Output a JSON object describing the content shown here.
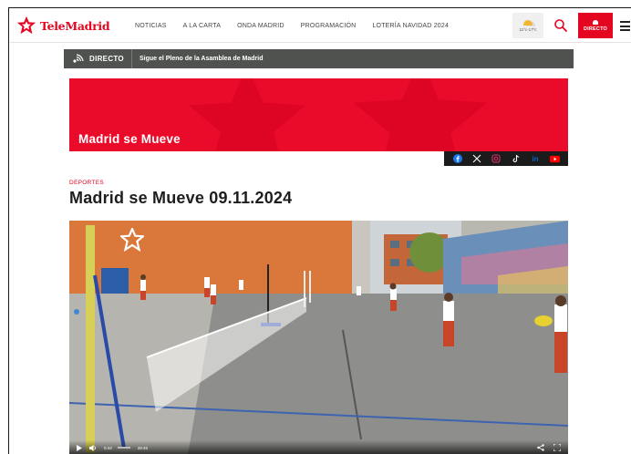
{
  "header": {
    "logo_text": "TeleMadrid",
    "nav": [
      "NOTICIAS",
      "A LA CARTA",
      "ONDA MADRID",
      "PROGRAMACIÓN",
      "LOTERÍA NAVIDAD 2024"
    ],
    "weather_text": "11ºc-17ºc",
    "directo_label": "DIRECTO",
    "brand_color": "#e40521"
  },
  "live": {
    "label": "DIRECTO",
    "text": "Sigue el Pleno de la Asamblea de Madrid"
  },
  "banner": {
    "title": "Madrid se Mueve",
    "background": "#ea0a2a"
  },
  "social": [
    "facebook-icon",
    "x-icon",
    "instagram-icon",
    "tiktok-icon",
    "linkedin-icon",
    "youtube-icon"
  ],
  "article": {
    "category": "DEPORTES",
    "title": "Madrid se Mueve 09.11.2024"
  },
  "video": {
    "current_time": "0:44",
    "duration": "28:46",
    "progress_fraction": 0.03
  }
}
